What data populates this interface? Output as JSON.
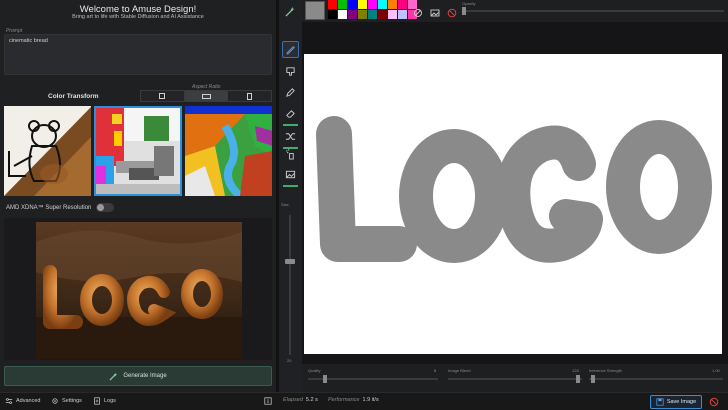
{
  "header": {
    "title": "Welcome to Amuse Design!",
    "subtitle": "Bring art to life with Stable Diffusion and AI Assistance"
  },
  "prompt": {
    "label": "Prompt",
    "value": "cinematic bread"
  },
  "aspect": {
    "label": "Aspect Ratio",
    "selected": "16:9"
  },
  "color_transform": {
    "label": "Color Transform"
  },
  "super_resolution": {
    "label": "AMD XDNA™ Super Resolution",
    "enabled": false
  },
  "generate": {
    "label": "Generate Image"
  },
  "toolbar": {
    "tools": [
      "draw-brush",
      "stamp",
      "pen",
      "eraser",
      "shuffle",
      "spray",
      "fill-image"
    ],
    "size_label": "Size",
    "size_value": "20"
  },
  "palette": {
    "current": "#8a8a8a",
    "colors": [
      "#ff0000",
      "#00c000",
      "#0000ff",
      "#ffff00",
      "#ff00ff",
      "#00ffff",
      "#ff8000",
      "#ff0080",
      "#ff66cc",
      "#000000",
      "#ffffff",
      "#800080",
      "#808000",
      "#008080",
      "#800000",
      "#ffc0ff",
      "#c0c0ff",
      "#ff33aa"
    ],
    "opacity_label": "Opacity"
  },
  "canvas": {
    "text": "LOGO"
  },
  "bottom": {
    "quality_label": "Quality",
    "quality_value": "8",
    "blend_label": "Image Blend",
    "blend_value": "128",
    "strength_label": "Inference Strength",
    "strength_value": "1.00"
  },
  "status": {
    "advanced": "Advanced",
    "settings": "Settings",
    "logs": "Logs",
    "elapsed_label": "Elapsed",
    "elapsed_value": "5.2 s",
    "performance_label": "Performance",
    "performance_value": "1.9 it/s",
    "save_label": "Save Image"
  },
  "colors": {
    "accent": "#2f8fd8",
    "generate_bg": "#2a3b35",
    "active_bar": "#3fae6b",
    "stroke": "#8a8a8a"
  }
}
